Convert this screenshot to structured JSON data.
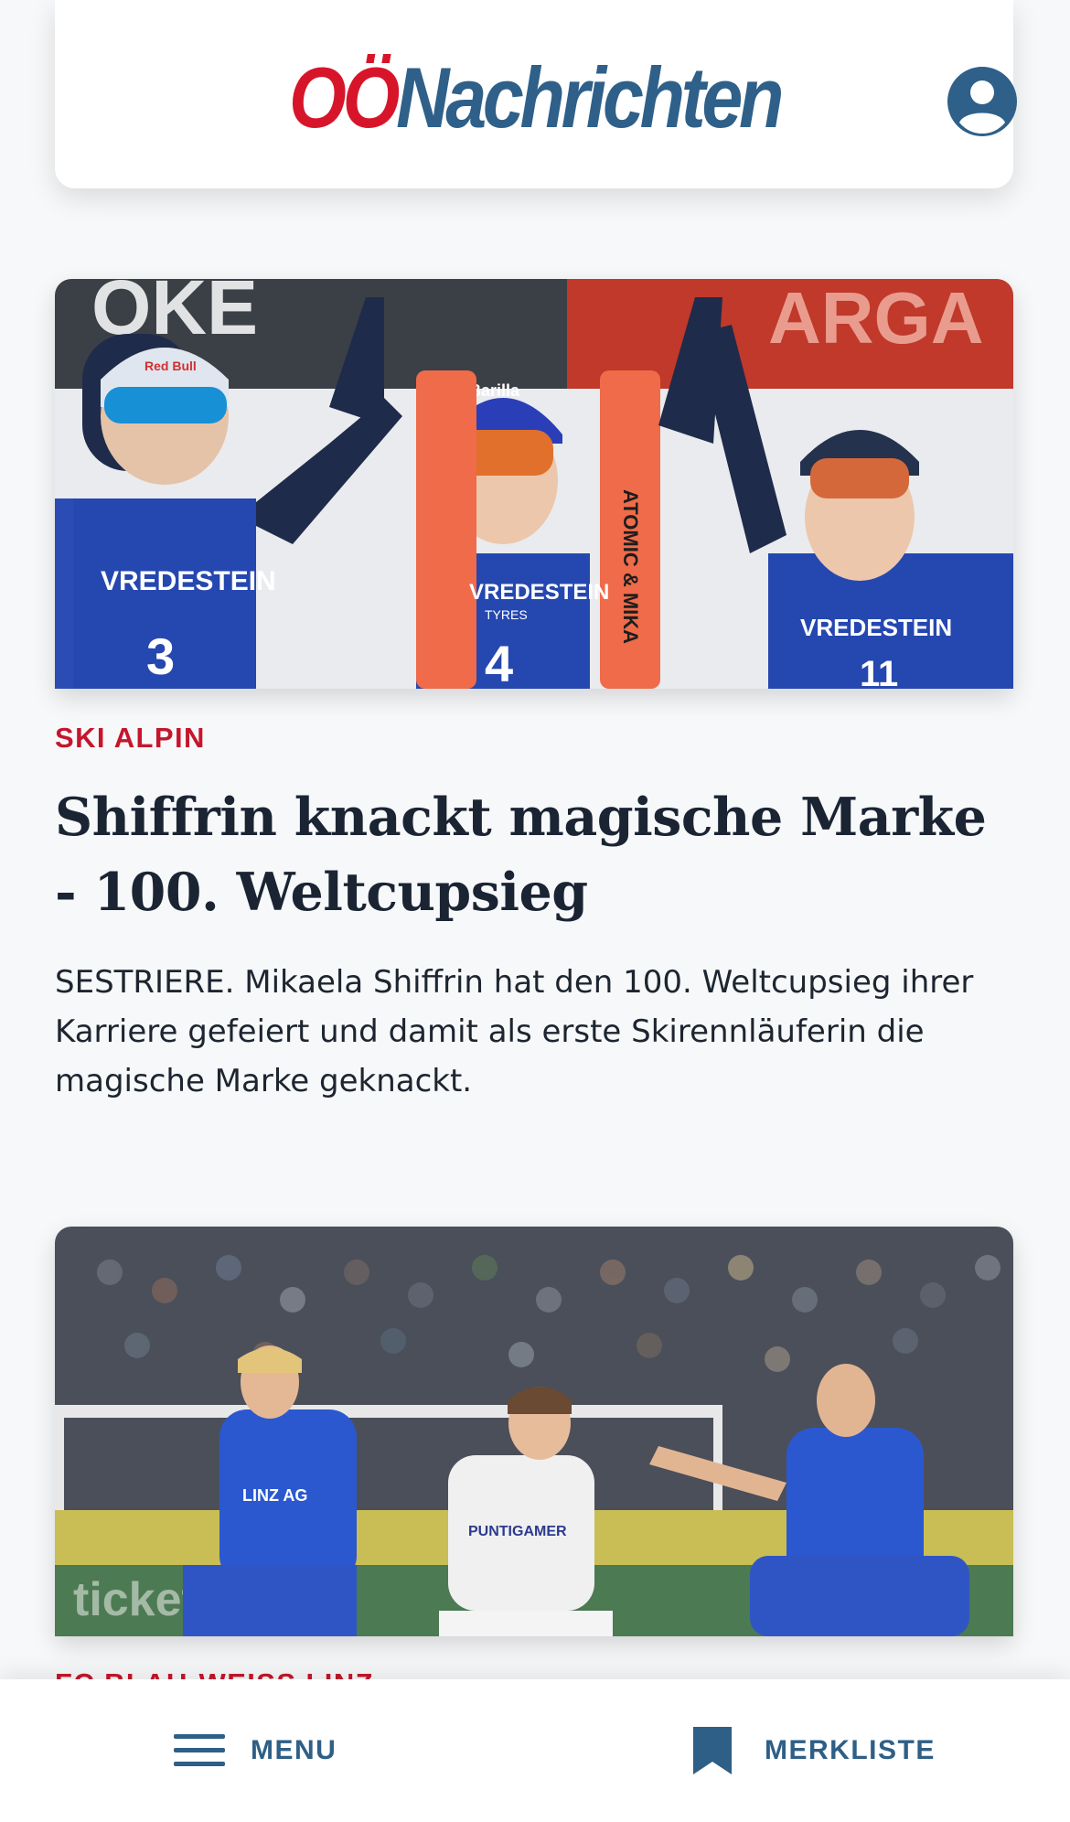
{
  "header": {
    "logo_part1": "OÖ",
    "logo_part2": "Nachrichten",
    "user_icon": "user-circle-icon"
  },
  "articles": [
    {
      "kicker": "SKI ALPIN",
      "title": "Shiffrin knackt magische Marke - 100. Weltcupsieg",
      "teaser": "SESTRIERE. Mikaela Shiffrin hat den 100. Weltcupsieg ihrer Karriere gefeiert und damit als erste Skirennläuferin die magische Marke geknackt.",
      "image": {
        "bibs": [
          "3",
          "4",
          "11"
        ],
        "sponsor": "VREDESTEIN",
        "sponsor_sub": "TYRES",
        "ski_text": "ATOMIC & MIKA",
        "helmet_text": "Barilla",
        "helmet_text_left": "Red Bull"
      }
    },
    {
      "kicker": "FC BLAU-WEISS LINZ",
      "image": {
        "jersey_text": "PUNTIGAMER",
        "shirt_sponsor": "LINZ AG"
      }
    }
  ],
  "bottom_nav": {
    "menu_label": "MENU",
    "merkliste_label": "MERKLISTE",
    "menu_icon": "hamburger-icon",
    "merkliste_icon": "bookmark-icon"
  },
  "colors": {
    "brand_red": "#d7152a",
    "brand_blue": "#2e6089",
    "kicker_red": "#c5162c",
    "text_dark": "#1a2433"
  }
}
